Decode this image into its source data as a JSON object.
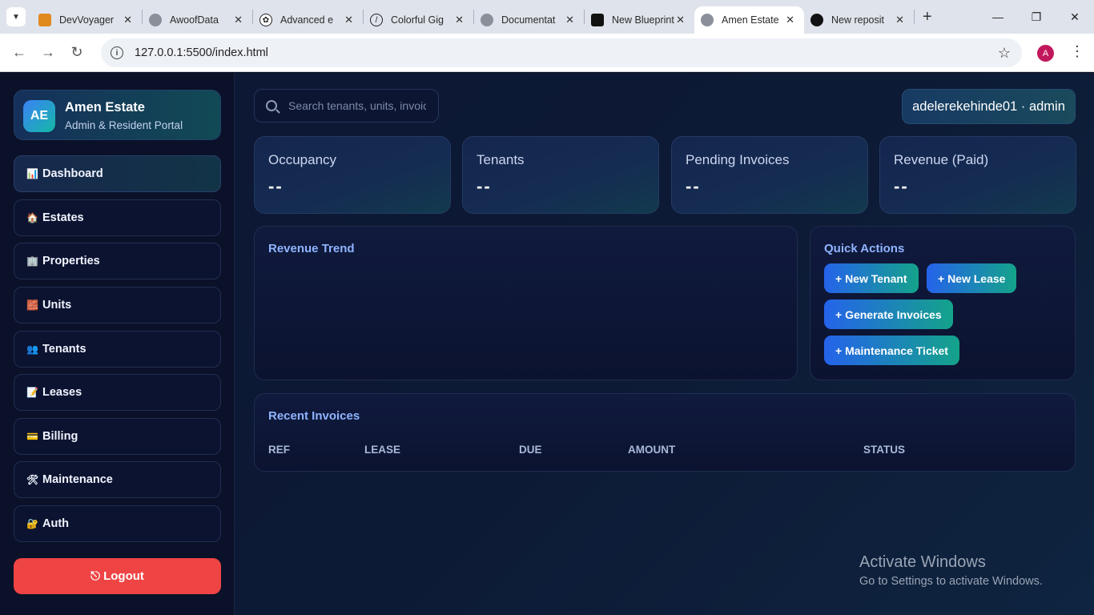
{
  "browser": {
    "tabs": [
      {
        "title": "DevVoyager",
        "fav": "tab-icon-orange"
      },
      {
        "title": "AwoofData",
        "fav": "globe"
      },
      {
        "title": "Advanced e",
        "fav": "openai"
      },
      {
        "title": "Colorful Gig",
        "fav": "slash"
      },
      {
        "title": "Documentat",
        "fav": "globe"
      },
      {
        "title": "New Blueprint",
        "fav": "blueprint"
      },
      {
        "title": "Amen Estate",
        "fav": "globe",
        "active": true
      },
      {
        "title": "New reposit",
        "fav": "github"
      }
    ],
    "url": "127.0.0.1:5500/index.html",
    "profile_initial": "A"
  },
  "sidebar": {
    "brand_initials": "AE",
    "brand_name": "Amen Estate",
    "brand_sub": "Admin & Resident Portal",
    "items": [
      {
        "label": "Dashboard",
        "icon": "📊"
      },
      {
        "label": "Estates",
        "icon": "🏠"
      },
      {
        "label": "Properties",
        "icon": "🏢"
      },
      {
        "label": "Units",
        "icon": "🧱"
      },
      {
        "label": "Tenants",
        "icon": "👥"
      },
      {
        "label": "Leases",
        "icon": "📝"
      },
      {
        "label": "Billing",
        "icon": "💳"
      },
      {
        "label": "Maintenance",
        "icon": "🛠"
      },
      {
        "label": "Auth",
        "icon": "🔐"
      }
    ],
    "logout_label": "⎋ Logout"
  },
  "header": {
    "search_placeholder": "Search tenants, units, invoices",
    "user_label": "adelerekehinde01 · admin"
  },
  "stats": [
    {
      "label": "Occupancy",
      "value": "--"
    },
    {
      "label": "Tenants",
      "value": "--"
    },
    {
      "label": "Pending Invoices",
      "value": "--"
    },
    {
      "label": "Revenue (Paid)",
      "value": "--"
    }
  ],
  "revenue": {
    "title": "Revenue Trend"
  },
  "quick_actions": {
    "title": "Quick Actions",
    "buttons": [
      "+ New Tenant",
      "+ New Lease",
      "+ Generate Invoices",
      "+ Maintenance Ticket"
    ]
  },
  "invoices": {
    "title": "Recent Invoices",
    "columns": [
      "REF",
      "LEASE",
      "DUE",
      "AMOUNT",
      "STATUS"
    ]
  },
  "watermark": {
    "line1": "Activate Windows",
    "line2": "Go to Settings to activate Windows."
  },
  "colors": {
    "accent": "#8fb4ff",
    "logout": "#ef4444",
    "bg": "#0b1224"
  }
}
